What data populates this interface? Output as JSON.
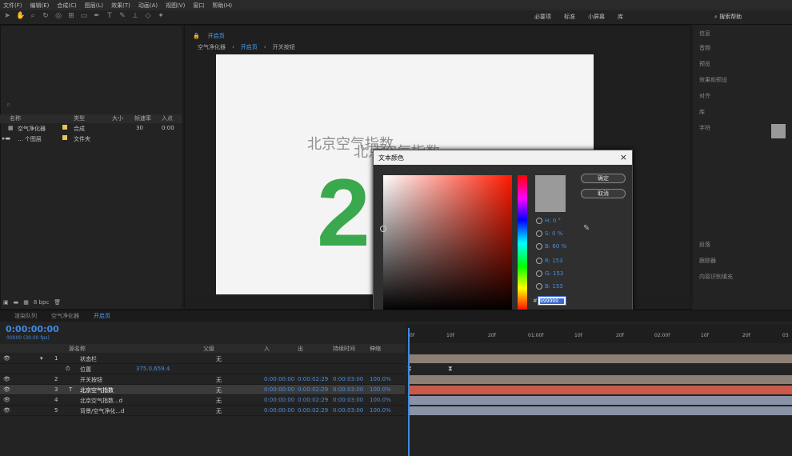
{
  "menu": [
    "文件(F)",
    "编辑(E)",
    "合成(C)",
    "图层(L)",
    "效果(T)",
    "动画(A)",
    "视图(V)",
    "窗口",
    "帮助(H)"
  ],
  "workspaces": [
    "必要项",
    "标准",
    "小屏幕",
    "库"
  ],
  "search": {
    "label": "搜索帮助"
  },
  "project": {
    "columns": {
      "name": "名称",
      "type": "类型",
      "size": "大小",
      "fps": "帧速率",
      "in": "入点"
    },
    "rows": [
      {
        "name": "空气净化器",
        "type": "合成",
        "fps": "30",
        "in": "0:00"
      },
      {
        "name": "... 个图层",
        "type": "文件夹",
        "fps": "",
        "in": ""
      }
    ],
    "bpc": "8 bpc"
  },
  "comp": {
    "tab": "开启页",
    "crumbs": [
      "空气净化器",
      "开启页",
      "开关按钮"
    ],
    "canvas_text_1": "北京空气指数",
    "canvas_text_2": "北京空气指数",
    "big_number": "2"
  },
  "color_dialog": {
    "title": "文本颜色",
    "close": "×",
    "ok": "确定",
    "cancel": "取消",
    "h": "H: 0 °",
    "s": "S: 0 %",
    "b": "B: 60 %",
    "r": "R: 153",
    "g": "G: 153",
    "bv": "B: 153",
    "hash": "#",
    "hex": "999999",
    "preview_color": "#999999"
  },
  "right_panel": {
    "items": [
      "信息",
      "音频",
      "预览",
      "效果和预设",
      "对齐",
      "库",
      "字符",
      "段落",
      "跟踪器",
      "内容识别填充"
    ]
  },
  "timeline": {
    "tabs": [
      "渲染队列",
      "空气净化器",
      "开启页"
    ],
    "timecode": "0:00:00:00",
    "fps_note": "00000 (30.00 fps)",
    "columns": {
      "name": "源名称",
      "parent": "父级",
      "in": "入",
      "out": "出",
      "duration": "持续时间",
      "stretch": "伸缩"
    },
    "layers": [
      {
        "num": "1",
        "name": "状态栏",
        "parent": "无",
        "in": "",
        "out": "",
        "dur": "",
        "stretch": ""
      },
      {
        "num": "",
        "name": "位置",
        "parent": "",
        "in": "",
        "out": "",
        "dur": "",
        "stretch": "",
        "value": "375.0,659.4"
      },
      {
        "num": "2",
        "name": "开关按钮",
        "parent": "无",
        "in": "0:00:00:00",
        "out": "0:00:02:29",
        "dur": "0:00:03:00",
        "stretch": "100.0%"
      },
      {
        "num": "3",
        "name": "北京空气指数",
        "parent": "无",
        "in": "0:00:00:00",
        "out": "0:00:02:29",
        "dur": "0:00:03:00",
        "stretch": "100.0%"
      },
      {
        "num": "4",
        "name": "北京空气指数...d",
        "parent": "无",
        "in": "0:00:00:00",
        "out": "0:00:02:29",
        "dur": "0:00:03:00",
        "stretch": "100.0%"
      },
      {
        "num": "5",
        "name": "背景/空气净化...d",
        "parent": "无",
        "in": "0:00:00:00",
        "out": "0:00:02:29",
        "dur": "0:00:03:00",
        "stretch": "100.0%"
      }
    ],
    "ruler": [
      "0f",
      "10f",
      "20f",
      "01:00f",
      "10f",
      "20f",
      "02:00f",
      "10f",
      "20f",
      "03"
    ]
  }
}
